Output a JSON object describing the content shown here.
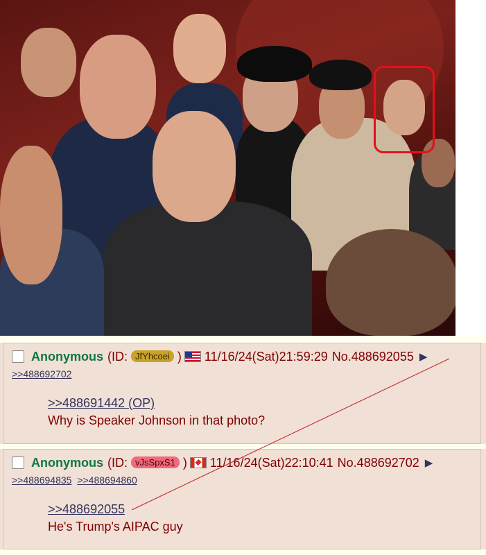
{
  "photo": {
    "alt": "",
    "highlight_color": "#e3101a"
  },
  "colors": {
    "post_bg": "#f0e0d6",
    "name": "#117743",
    "text": "#800000",
    "link": "#34345c",
    "id_badge_1": "#c9a227",
    "id_badge_2": "#f06a7a"
  },
  "posts": [
    {
      "name": "Anonymous",
      "id_prefix": "(ID:",
      "id": "JfYhcoei",
      "id_suffix": ")",
      "flag": "us-flag",
      "datetime": "11/16/24(Sat)21:59:29",
      "post_no": "No.488692055",
      "backlinks": [
        ">>488692702"
      ],
      "quote": ">>488691442 (OP)",
      "message": "Why is Speaker Johnson in that photo?"
    },
    {
      "name": "Anonymous",
      "id_prefix": "(ID:",
      "id": "vJsSpxS1",
      "id_suffix": ")",
      "flag": "canada-flag",
      "datetime": "11/16/24(Sat)22:10:41",
      "post_no": "No.488692702",
      "backlinks": [
        ">>488694835",
        ">>488694860"
      ],
      "quote": ">>488692055",
      "message": "He's Trump's AIPAC guy"
    }
  ]
}
